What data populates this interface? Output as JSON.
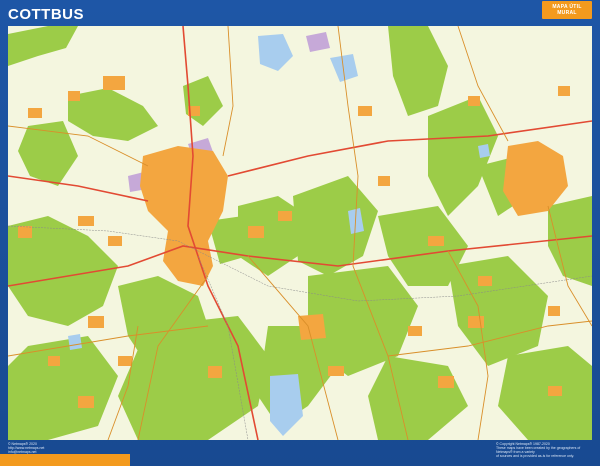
{
  "header": {
    "title": "COTTBUS",
    "badge_line1": "MAPA ÚTIL",
    "badge_line2": "MURAL"
  },
  "footer": {
    "left_line1": "© Netmaps® 2020",
    "left_line2": "http://www.netmaps.net",
    "left_line3": "info@netmaps.net",
    "right_line1": "© Copyright Netmaps® 1987-2020",
    "right_line2": "These maps have been created by the geographers of Netmaps® from a variety",
    "right_line3": "of sources and is provided as-is for reference only."
  },
  "colors": {
    "frame": "#1c4f9b",
    "land": "#f4f6df",
    "forest": "#9ccc48",
    "urban": "#f3a640",
    "water": "#a8cdee",
    "road": "#e24a33",
    "accent": "#f39a1e"
  }
}
